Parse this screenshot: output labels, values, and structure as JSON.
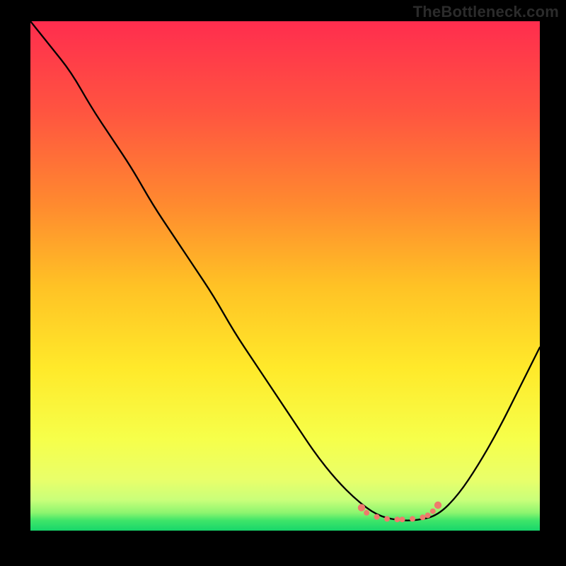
{
  "watermark": "TheBottleneck.com",
  "chart_data": {
    "type": "line",
    "title": "",
    "xlabel": "",
    "ylabel": "",
    "xlim": [
      0,
      100
    ],
    "ylim": [
      0,
      100
    ],
    "grid": false,
    "series": [
      {
        "name": "curve",
        "color": "#000000",
        "x": [
          0,
          4,
          8,
          12,
          16,
          20,
          24,
          28,
          32,
          36,
          40,
          44,
          48,
          52,
          56,
          60,
          64,
          68,
          72,
          76,
          80,
          84,
          88,
          92,
          96,
          100
        ],
        "y": [
          100,
          95,
          90,
          83,
          77,
          71,
          64,
          58,
          52,
          46,
          39,
          33,
          27,
          21,
          15,
          10,
          6,
          3,
          2,
          2,
          3,
          7,
          13,
          20,
          28,
          36
        ]
      },
      {
        "name": "highlight-dots",
        "color": "#ee7b6c",
        "x": [
          65,
          66,
          68,
          70,
          72,
          73,
          75,
          77,
          78,
          79,
          80
        ],
        "y": [
          4.5,
          3.5,
          2.7,
          2.3,
          2.2,
          2.2,
          2.3,
          2.6,
          3.0,
          3.8,
          5.0
        ]
      }
    ],
    "gradient_stops": [
      {
        "offset": 0.0,
        "color": "#ff2d4e"
      },
      {
        "offset": 0.18,
        "color": "#ff5540"
      },
      {
        "offset": 0.36,
        "color": "#ff8a2f"
      },
      {
        "offset": 0.52,
        "color": "#ffc225"
      },
      {
        "offset": 0.68,
        "color": "#ffe92a"
      },
      {
        "offset": 0.82,
        "color": "#f6ff4a"
      },
      {
        "offset": 0.9,
        "color": "#e9ff6a"
      },
      {
        "offset": 0.94,
        "color": "#c9ff7a"
      },
      {
        "offset": 0.965,
        "color": "#8cf56f"
      },
      {
        "offset": 0.98,
        "color": "#3fe569"
      },
      {
        "offset": 1.0,
        "color": "#17d66a"
      }
    ]
  }
}
